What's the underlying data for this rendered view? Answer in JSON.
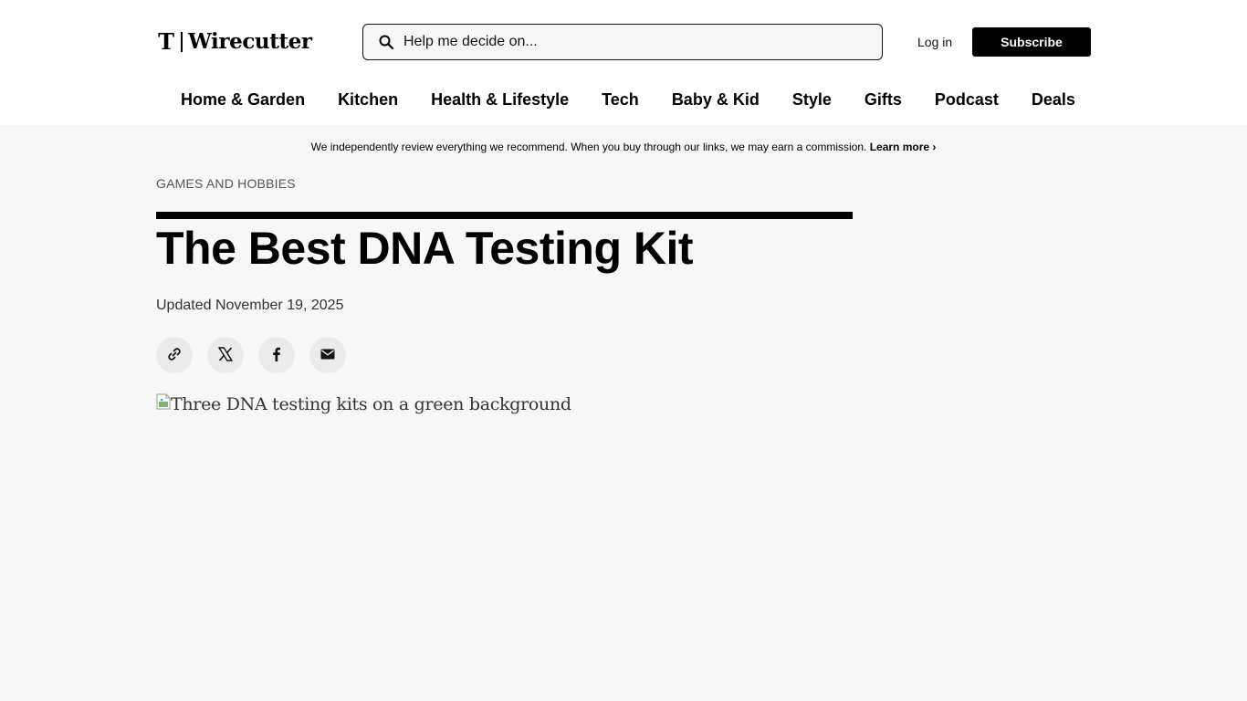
{
  "header": {
    "logo_text": "Wirecutter",
    "search": {
      "placeholder": "Help me decide on..."
    },
    "login_label": "Log in",
    "subscribe_label": "Subscribe"
  },
  "nav": {
    "items": [
      "Home & Garden",
      "Kitchen",
      "Health & Lifestyle",
      "Tech",
      "Baby & Kid",
      "Style",
      "Gifts",
      "Podcast",
      "Deals"
    ]
  },
  "disclosure": {
    "text": "We independently review everything we recommend. When you buy through our links, we may earn a commission.",
    "link_label": "Learn more ›"
  },
  "article": {
    "category": "GAMES AND HOBBIES",
    "title": "The Best DNA Testing Kit",
    "updated": "Updated November 19, 2025",
    "share": [
      {
        "icon": "link-icon"
      },
      {
        "icon": "x-icon"
      },
      {
        "icon": "facebook-icon"
      },
      {
        "icon": "email-icon"
      }
    ],
    "hero_alt": "Three DNA testing kits on a green background"
  }
}
